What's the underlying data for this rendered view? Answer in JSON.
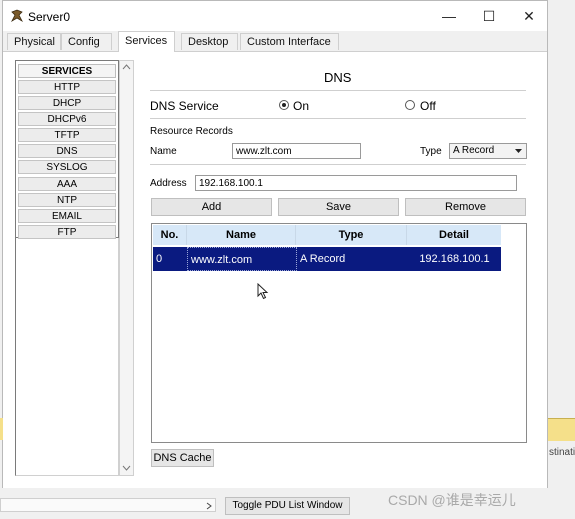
{
  "window": {
    "title": "Server0",
    "minimize": "—",
    "maximize": "☐",
    "close": "✕"
  },
  "tabs": [
    "Physical",
    "Config",
    "Services",
    "Desktop",
    "Custom Interface"
  ],
  "services": {
    "header": "SERVICES",
    "items": [
      "HTTP",
      "DHCP",
      "DHCPv6",
      "TFTP",
      "DNS",
      "SYSLOG",
      "AAA",
      "NTP",
      "EMAIL",
      "FTP"
    ]
  },
  "dns": {
    "heading": "DNS",
    "service_label": "DNS Service",
    "on_label": "On",
    "off_label": "Off",
    "resource_records_label": "Resource Records",
    "name_label": "Name",
    "name_value": "www.zlt.com",
    "type_label": "Type",
    "type_value": "A Record",
    "address_label": "Address",
    "address_value": "192.168.100.1",
    "add_button": "Add",
    "save_button": "Save",
    "remove_button": "Remove",
    "dns_cache_button": "DNS Cache"
  },
  "table": {
    "headers": [
      "No.",
      "Name",
      "Type",
      "Detail"
    ],
    "rows": [
      {
        "no": "0",
        "name": "www.zlt.com",
        "type": "A Record",
        "detail": "192.168.100.1"
      }
    ]
  },
  "bottom": {
    "toggle_pdu": "Toggle PDU List Window",
    "watermark": "CSDN @谁是幸运儿",
    "right_edge_text": "stinati"
  }
}
